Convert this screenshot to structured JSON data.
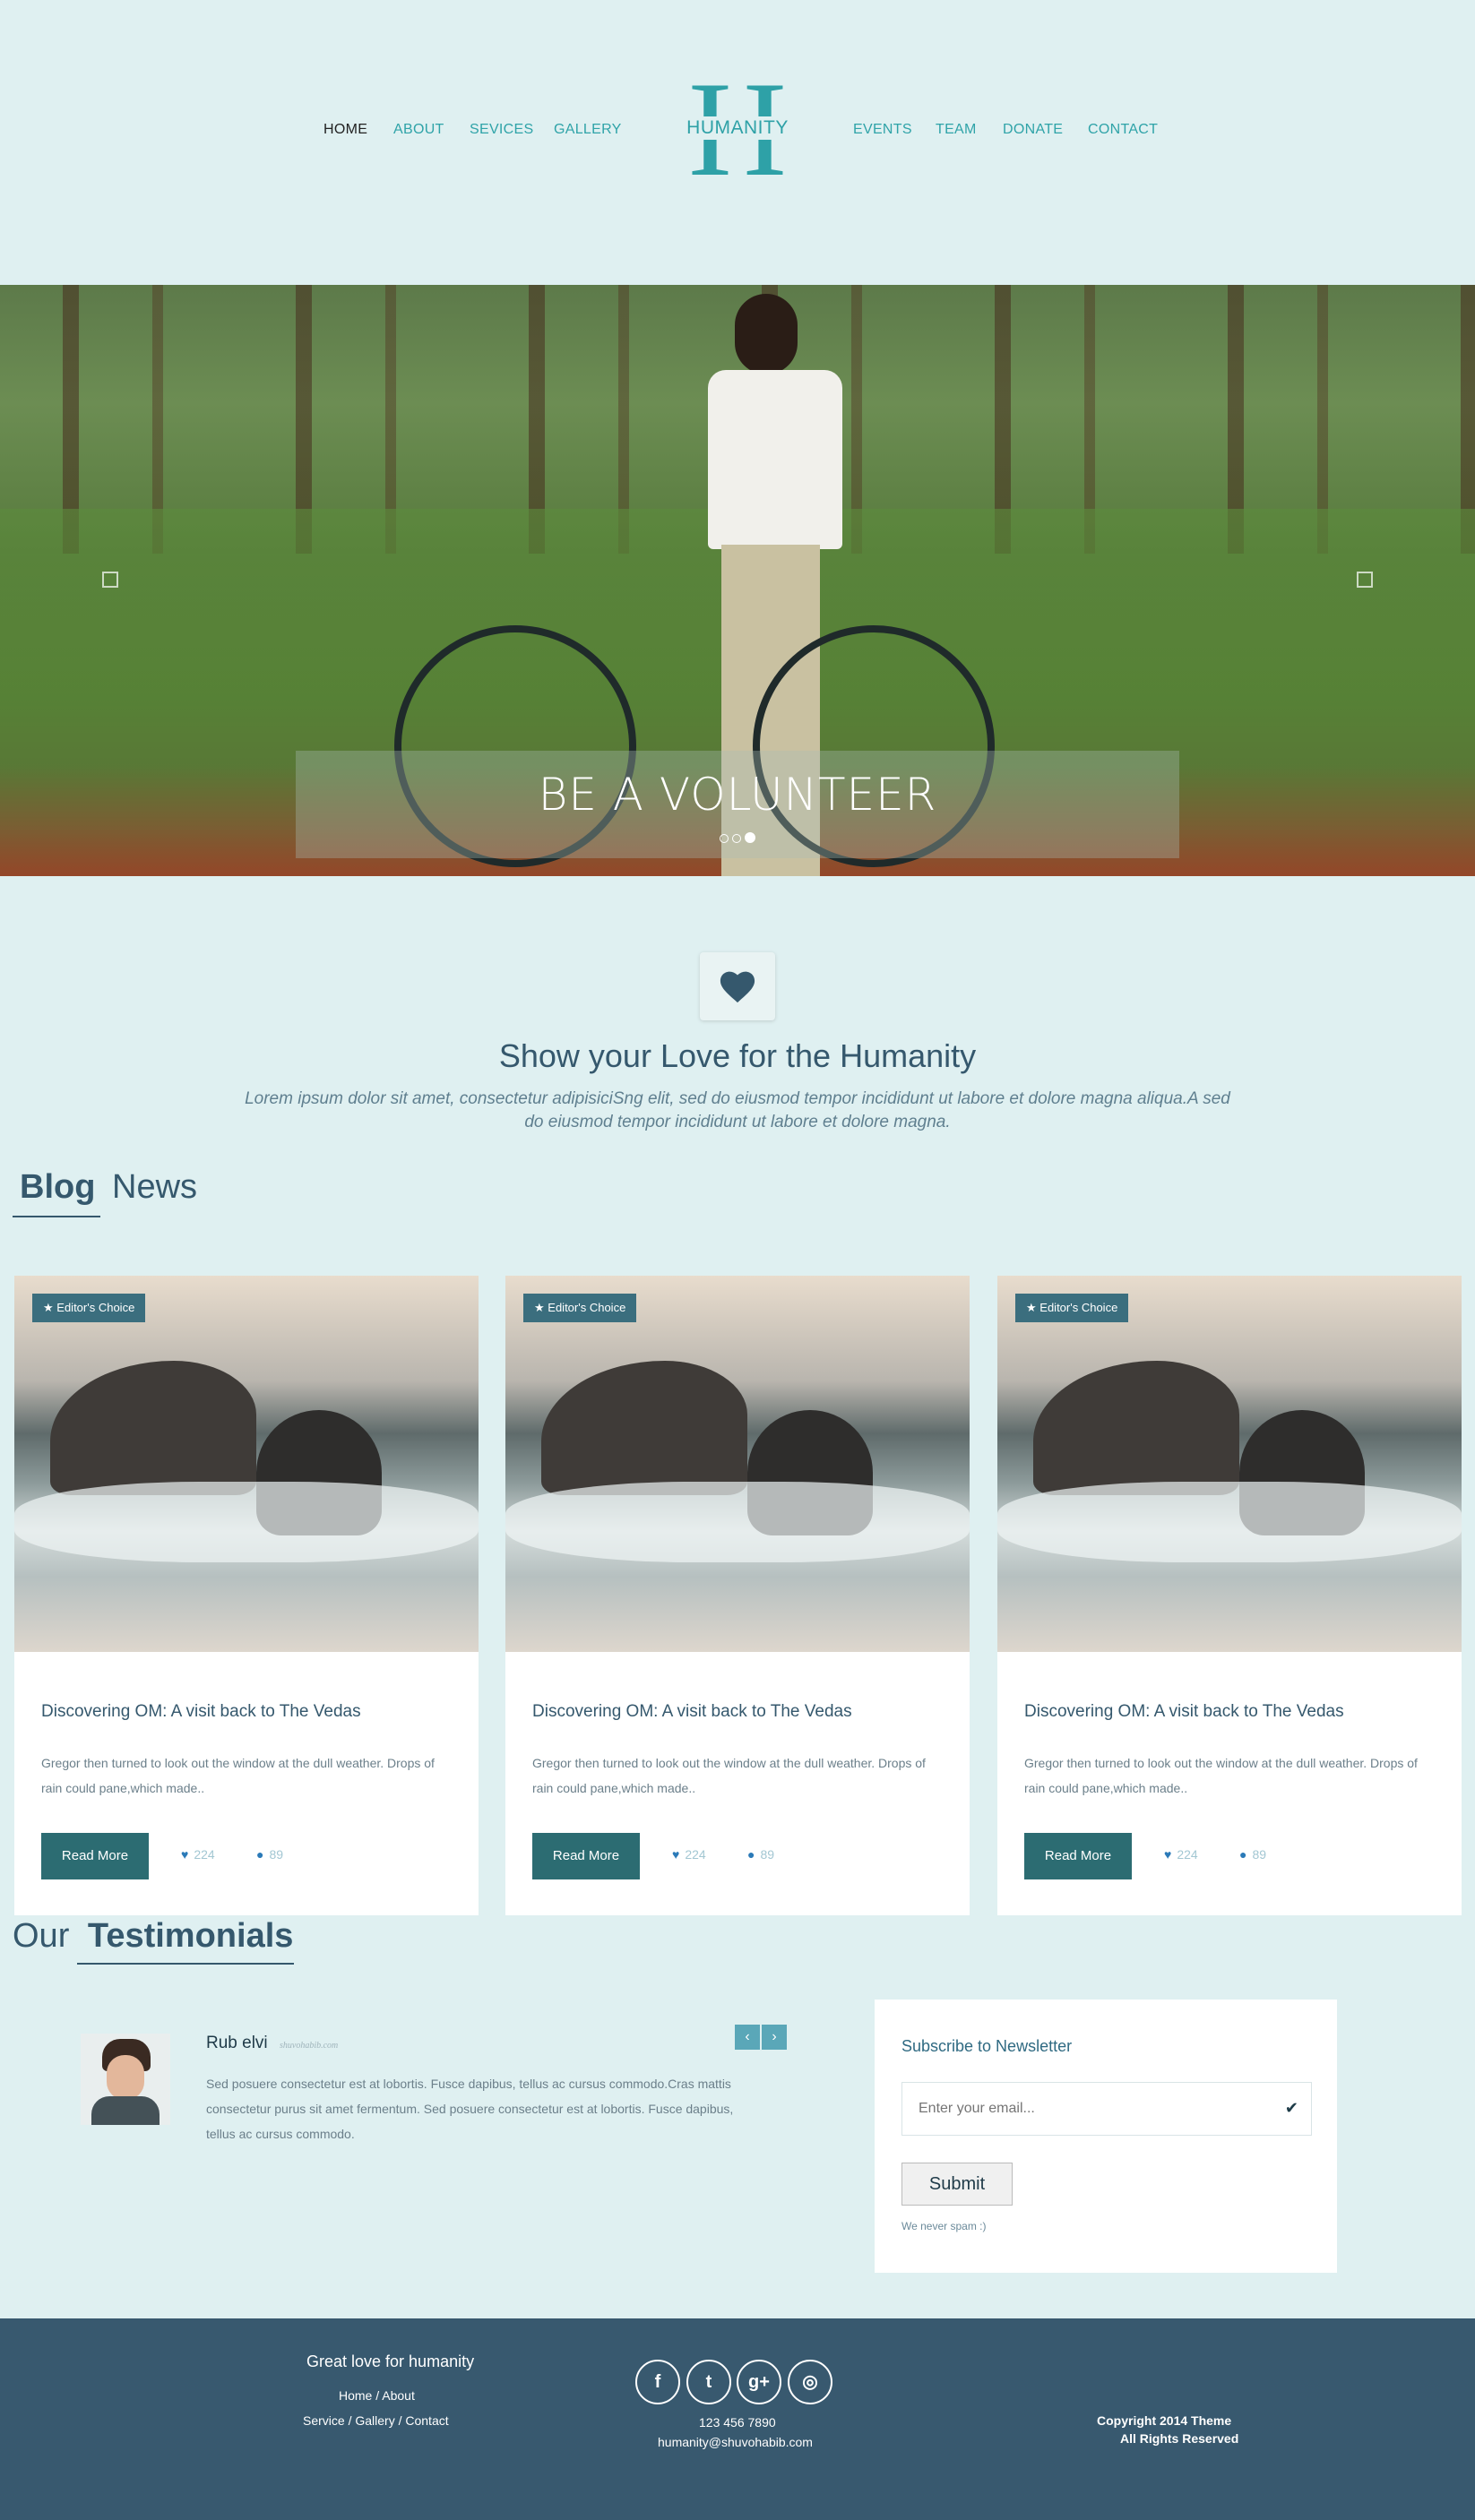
{
  "nav": {
    "left": [
      "HOME",
      "ABOUT",
      "SEVICES",
      "GALLERY"
    ],
    "right": [
      "EVENTS",
      "TEAM",
      "DONATE",
      "CONTACT"
    ],
    "logo_letter": "H",
    "logo_word": "HUMANITY"
  },
  "hero": {
    "caption": "BE A VOLUNTEER",
    "slide_count": 3,
    "active_slide": 3
  },
  "love": {
    "title": "Show your Love for the Humanity",
    "text": "Lorem ipsum dolor sit amet, consectetur adipisiciSng elit, sed do eiusmod tempor incididunt ut labore et dolore magna aliqua.A sed do eiusmod tempor incididunt ut labore et dolore magna."
  },
  "blog": {
    "heading_bold": "Blog",
    "heading_rest": "News",
    "cards": [
      {
        "badge": "Editor's Choice",
        "title": "Discovering OM: A visit back to The Vedas",
        "text": "Gregor then turned to look out the window at the dull weather. Drops of rain could pane,which made..",
        "button": "Read More",
        "likes": "224",
        "comments": "89"
      },
      {
        "badge": "Editor's Choice",
        "title": "Discovering OM: A visit back to The Vedas",
        "text": "Gregor then turned to look out the window at the dull weather. Drops of rain could pane,which made..",
        "button": "Read More",
        "likes": "224",
        "comments": "89"
      },
      {
        "badge": "Editor's Choice",
        "title": "Discovering OM: A visit back to The Vedas",
        "text": "Gregor then turned to look out the window at the dull weather. Drops of rain could pane,which made..",
        "button": "Read More",
        "likes": "224",
        "comments": "89"
      }
    ]
  },
  "testimonials": {
    "heading_rest": "Our",
    "heading_bold": "Testimonials",
    "name": "Rub elvi",
    "site": "shuvohabib.com",
    "text": "Sed posuere consectetur est at lobortis. Fusce dapibus, tellus ac cursus commodo.Cras mattis consectetur purus sit amet fermentum. Sed posuere consectetur est at lobortis. Fusce dapibus, tellus ac cursus commodo.",
    "prev": "‹",
    "next": "›"
  },
  "newsletter": {
    "title": "Subscribe to Newsletter",
    "placeholder": "Enter your email...",
    "submit": "Submit",
    "note": "We never spam :)"
  },
  "footer": {
    "tagline": "Great love for humanity",
    "links1": "Home / About",
    "links2": "Service / Gallery / Contact",
    "social": [
      "f",
      "t",
      "g+",
      "◎"
    ],
    "phone": "123 456 7890",
    "email": "humanity@shuvohabib.com",
    "copyright1": "Copyright 2014 Theme",
    "copyright2": "All Rights Reserved"
  },
  "colors": {
    "background": "#dff0f1",
    "teal": "#2ea1a7",
    "dark": "#35586d",
    "button": "#2c6c72",
    "footer": "#38596f"
  }
}
